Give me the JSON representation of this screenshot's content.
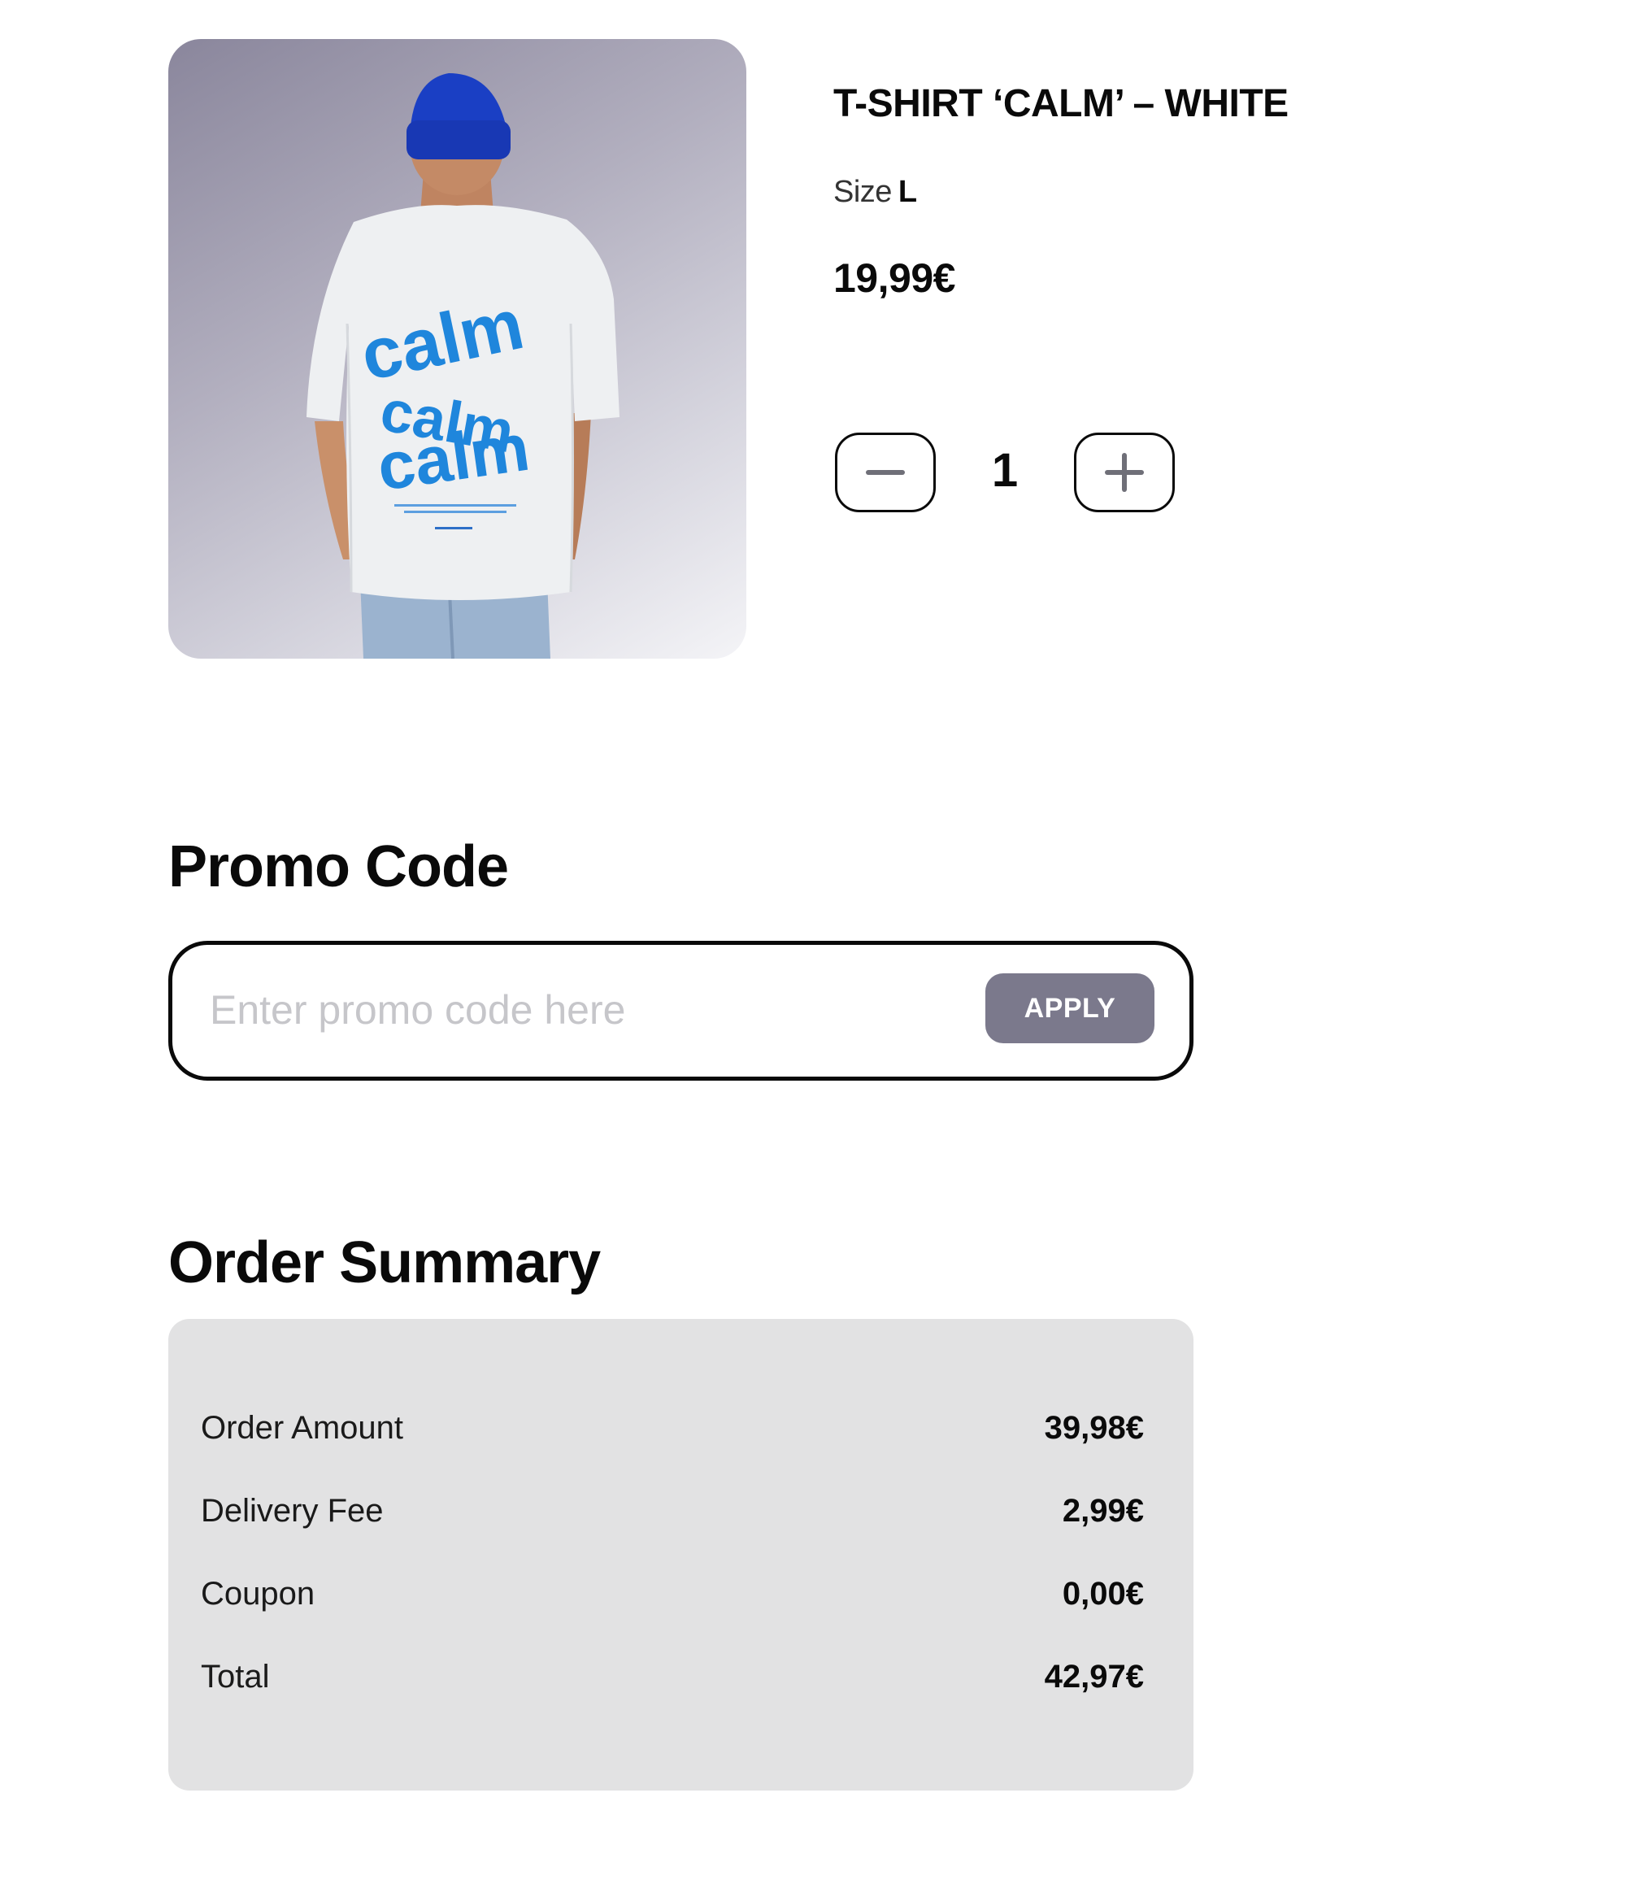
{
  "product": {
    "title": "T-SHIRT ‘CALM’ – WHITE",
    "size_label": "Size",
    "size_value": "L",
    "price": "19,99€",
    "image_print_text": "calm calm calm",
    "quantity": "1"
  },
  "promo": {
    "heading": "Promo Code",
    "placeholder": "Enter promo code here",
    "value": "",
    "apply_label": "APPLY"
  },
  "summary": {
    "heading": "Order Summary",
    "rows": [
      {
        "label": "Order Amount",
        "value": "39,98€"
      },
      {
        "label": "Delivery Fee",
        "value": "2,99€"
      },
      {
        "label": "Coupon",
        "value": "0,00€"
      },
      {
        "label": "Total",
        "value": "42,97€"
      }
    ]
  },
  "icons": {
    "minus": "minus-icon",
    "plus": "plus-icon"
  },
  "colors": {
    "apply_button": "#7b798c",
    "summary_card": "#e2e2e3",
    "print_blue": "#1f86dc",
    "beanie_blue": "#1a3fc4"
  }
}
